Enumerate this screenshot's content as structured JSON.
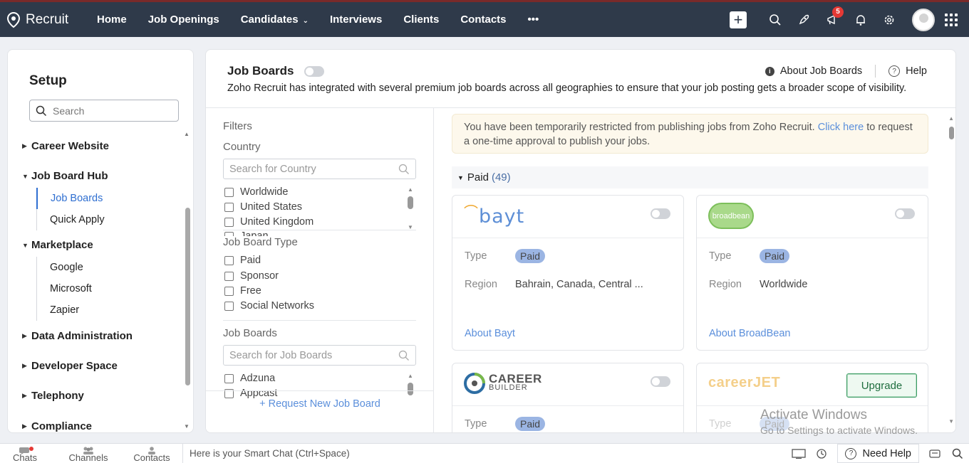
{
  "nav": {
    "brand": "Recruit",
    "links": [
      "Home",
      "Job Openings",
      "Candidates",
      "Interviews",
      "Clients",
      "Contacts"
    ],
    "more": "•••",
    "notification_count": "5"
  },
  "setup": {
    "title": "Setup",
    "search_placeholder": "Search",
    "sections": {
      "career_website": "Career Website",
      "job_board_hub": "Job Board Hub",
      "job_boards": "Job Boards",
      "quick_apply": "Quick Apply",
      "marketplace": "Marketplace",
      "google": "Google",
      "microsoft": "Microsoft",
      "zapier": "Zapier",
      "data_administration": "Data Administration",
      "developer_space": "Developer Space",
      "telephony": "Telephony",
      "compliance": "Compliance"
    }
  },
  "main": {
    "title": "Job Boards",
    "description": "Zoho Recruit has integrated with several premium job boards across all geographies to ensure that your job posting gets a broader scope of visibility.",
    "about_link": "About Job Boards",
    "help_link": "Help"
  },
  "filters": {
    "title": "Filters",
    "country_label": "Country",
    "country_search_placeholder": "Search for Country",
    "countries": [
      "Worldwide",
      "United States",
      "United Kingdom",
      "Japan"
    ],
    "type_label": "Job Board Type",
    "types": [
      "Paid",
      "Sponsor",
      "Free",
      "Social Networks"
    ],
    "boards_label": "Job Boards",
    "boards_search_placeholder": "Search for Job Boards",
    "boards": [
      "Adzuna",
      "Appcast"
    ],
    "request_link": "+ Request New Job Board"
  },
  "content": {
    "notice_text": "You have been temporarily restricted from publishing jobs from Zoho Recruit. ",
    "notice_link": "Click here",
    "notice_tail": " to request a one-time approval to publish your jobs.",
    "paid_label": "Paid",
    "paid_count": "(49)",
    "type_key": "Type",
    "region_key": "Region",
    "cards": [
      {
        "logo_text": "bayt",
        "type": "Paid",
        "region": "Bahrain, Canada, Central ...",
        "about": "About Bayt"
      },
      {
        "logo_text": "broadbean",
        "type": "Paid",
        "region": "Worldwide",
        "about": "About BroadBean"
      },
      {
        "logo_text": "CAREER",
        "logo_sub": "BUILDER",
        "type": "Paid"
      },
      {
        "logo_text": "careerJET",
        "type": "Paid",
        "upgrade": "Upgrade"
      }
    ]
  },
  "watermark": {
    "line1": "Activate Windows",
    "line2": "Go to Settings to activate Windows."
  },
  "bottombar": {
    "chats": "Chats",
    "channels": "Channels",
    "contacts": "Contacts",
    "chat_placeholder": "Here is your Smart Chat (Ctrl+Space)",
    "need_help": "Need Help"
  }
}
